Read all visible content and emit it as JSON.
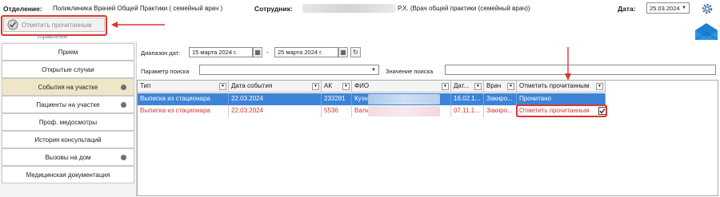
{
  "header": {
    "department_label": "Отделение:",
    "department_value": "Поликлиника Врачей Общей Практики ( семейный врач )",
    "employee_label": "Сотрудник:",
    "employee_value": "Р.Х. (Врач общей практики (семейный врач))",
    "date_label": "Дата:",
    "date_value": "25.03.2024"
  },
  "toolbar": {
    "mark_read_label": "Отметить прочитанным",
    "section_caption": "Управление"
  },
  "sidebar": {
    "items": [
      {
        "label": "Прием",
        "dot": false
      },
      {
        "label": "Открытые случаи",
        "dot": false
      },
      {
        "label": "События на участке",
        "dot": true,
        "active": true
      },
      {
        "label": "Пациенты на участке",
        "dot": true
      },
      {
        "label": "Проф. медосмотры",
        "dot": false
      },
      {
        "label": "История консультаций",
        "dot": false
      },
      {
        "label": "Вызовы на дом",
        "dot": true
      },
      {
        "label": "Медицинская документация",
        "dot": false
      }
    ]
  },
  "filters": {
    "range_label": "Диапазон дат:",
    "date_from": "15   марта   2024 г.",
    "date_sep": "-",
    "date_to": "25   марта   2024 г.",
    "param_label": "Параметр поиска",
    "param_value": "",
    "value_label": "Значение поиска",
    "value_value": ""
  },
  "table": {
    "columns": [
      "Тип",
      "Дата события",
      "АК",
      "ФИО",
      "Дат...",
      "Врач",
      "Отметить прочитанным"
    ],
    "rows": [
      {
        "type": "Выписка из стационара",
        "date": "22.03.2024",
        "ak": "233281",
        "fio": "Кузн",
        "dat": "16.02.1...",
        "doctor": "Закиро...",
        "mark": "Прочитано",
        "checked": false
      },
      {
        "type": "Выписка из стационара",
        "date": "22.03.2024",
        "ak": "5536",
        "fio": "Вали",
        "dat": "07.11.1...",
        "doctor": "Закиро...",
        "mark": "Отметить прочитанным",
        "checked": true
      }
    ]
  },
  "colors": {
    "accent_red": "#d9372f",
    "selection_blue": "#3d84d8",
    "active_nav": "#efe6c8"
  }
}
